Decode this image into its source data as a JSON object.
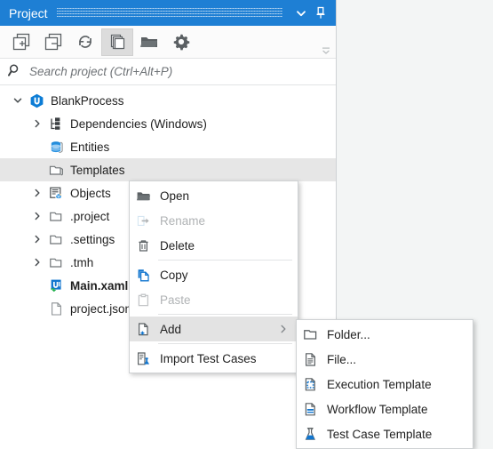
{
  "panel": {
    "title": "Project",
    "title_controls": [
      {
        "name": "chevron-down-icon",
        "label": "Minimize panel"
      },
      {
        "name": "pin-icon",
        "label": "Pin panel"
      }
    ],
    "toolbar": [
      {
        "name": "expand-all-icon",
        "label": "Expand All",
        "active": false
      },
      {
        "name": "collapse-all-icon",
        "label": "Collapse All",
        "active": false
      },
      {
        "name": "refresh-icon",
        "label": "Refresh",
        "active": false
      },
      {
        "name": "show-all-files-icon",
        "label": "Show All Files",
        "active": true
      },
      {
        "name": "open-folder-icon",
        "label": "Open Folder",
        "active": false
      },
      {
        "name": "settings-gear-icon",
        "label": "Settings",
        "active": false
      }
    ],
    "toolbar_overflow": "toolbar-overflow-icon",
    "search": {
      "icon": "search-icon",
      "placeholder": "Search project (Ctrl+Alt+P)",
      "value": ""
    }
  },
  "tree": {
    "nodes": [
      {
        "label": "BlankProcess",
        "icon": "uipath-project-icon",
        "twisty": "expanded",
        "indent": 0,
        "bold": false,
        "selected": false
      },
      {
        "label": "Dependencies (Windows)",
        "icon": "dependencies-icon",
        "twisty": "collapsed",
        "indent": 1,
        "bold": false,
        "selected": false
      },
      {
        "label": "Entities",
        "icon": "entities-database-icon",
        "twisty": "none",
        "indent": 1,
        "bold": false,
        "selected": false
      },
      {
        "label": "Templates",
        "icon": "folder-icon",
        "twisty": "none",
        "indent": 1,
        "bold": false,
        "selected": true
      },
      {
        "label": "Objects",
        "icon": "objects-icon",
        "twisty": "collapsed",
        "indent": 1,
        "bold": false,
        "selected": false
      },
      {
        "label": ".project",
        "icon": "folder-icon",
        "twisty": "collapsed",
        "indent": 1,
        "bold": false,
        "selected": false
      },
      {
        "label": ".settings",
        "icon": "folder-icon",
        "twisty": "collapsed",
        "indent": 1,
        "bold": false,
        "selected": false
      },
      {
        "label": ".tmh",
        "icon": "folder-icon",
        "twisty": "collapsed",
        "indent": 1,
        "bold": false,
        "selected": false
      },
      {
        "label": "Main.xaml",
        "icon": "uipath-xaml-icon",
        "twisty": "none",
        "indent": 1,
        "bold": true,
        "selected": false
      },
      {
        "label": "project.json",
        "icon": "file-icon",
        "twisty": "none",
        "indent": 1,
        "bold": false,
        "selected": false
      }
    ]
  },
  "context_menu": {
    "items": [
      {
        "label": "Open",
        "icon": "open-folder-icon",
        "disabled": false,
        "highlight": false,
        "submenu": false,
        "separator_after": false
      },
      {
        "label": "Rename",
        "icon": "rename-icon",
        "disabled": true,
        "highlight": false,
        "submenu": false,
        "separator_after": false
      },
      {
        "label": "Delete",
        "icon": "trash-icon",
        "disabled": false,
        "highlight": false,
        "submenu": false,
        "separator_after": true
      },
      {
        "label": "Copy",
        "icon": "copy-icon",
        "disabled": false,
        "highlight": false,
        "submenu": false,
        "separator_after": false
      },
      {
        "label": "Paste",
        "icon": "paste-icon",
        "disabled": true,
        "highlight": false,
        "submenu": false,
        "separator_after": true
      },
      {
        "label": "Add",
        "icon": "add-file-icon",
        "disabled": false,
        "highlight": true,
        "submenu": true,
        "separator_after": true
      },
      {
        "label": "Import Test Cases",
        "icon": "import-tests-icon",
        "disabled": false,
        "highlight": false,
        "submenu": false,
        "separator_after": false
      }
    ]
  },
  "submenu": {
    "items": [
      {
        "label": "Folder...",
        "icon": "folder-outline-icon"
      },
      {
        "label": "File...",
        "icon": "file-outline-icon"
      },
      {
        "label": "Execution Template",
        "icon": "execution-template-icon"
      },
      {
        "label": "Workflow Template",
        "icon": "workflow-template-icon"
      },
      {
        "label": "Test Case Template",
        "icon": "test-case-template-icon"
      }
    ]
  },
  "colors": {
    "title_bar": "#1e7fd4",
    "accent_blue": "#0c7cd5",
    "selection_gray": "#e6e6e6",
    "menu_highlight": "#e3e3e3",
    "canvas": "#f3f5f5",
    "panel_bg": "#ffffff",
    "disabled_text": "#b0b3b5"
  }
}
